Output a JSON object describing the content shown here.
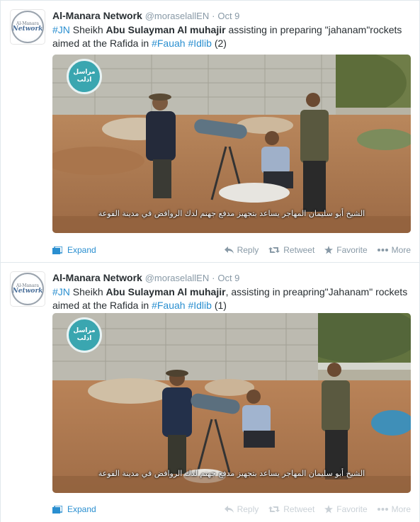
{
  "tweets": [
    {
      "avatar": {
        "line1": "Al-Manara",
        "line2": "Network"
      },
      "name": "Al-Manara Network",
      "handle": "@moraselallEN",
      "separator": "·",
      "time": "Oct 9",
      "text": {
        "hashtag1": "#JN",
        "p1": " Sheikh ",
        "bold": "Abu Sulayman Al muhajir",
        "p2": " assisting in preparing \"jahanam\"rockets aimed at the Rafida in ",
        "hashtag2": "#Fauah",
        "space": " ",
        "hashtag3": "#Idlib",
        "p3": " (2)"
      },
      "media": {
        "watermark_line1": "مراسل",
        "watermark_line2": "ادلب",
        "caption": "الشيخ أبو سليمان المهاجر يساعد بتجهيز مدفع جهنم لدك الروافض في مدينة الفوعة"
      },
      "actions": {
        "expand": "Expand",
        "reply": "Reply",
        "retweet": "Retweet",
        "favorite": "Favorite",
        "more": "More"
      }
    },
    {
      "avatar": {
        "line1": "Al-Manara",
        "line2": "Network"
      },
      "name": "Al-Manara Network",
      "handle": "@moraselallEN",
      "separator": "·",
      "time": "Oct 9",
      "text": {
        "hashtag1": "#JN",
        "p1": " Sheikh ",
        "bold": "Abu Sulayman Al muhajir",
        "p2": ", assisting in preapring\"Jahanam\" rockets aimed at the Rafida in ",
        "hashtag2": "#Fauah",
        "space": " ",
        "hashtag3": "#Idlib",
        "p3": " (1)"
      },
      "media": {
        "watermark_line1": "مراسل",
        "watermark_line2": "ادلب",
        "caption": "الشيخ أبو سليمان المهاجر يساعد بتجهيز مدفع جهنم لدك الروافض في مدينة الفوعة"
      },
      "actions": {
        "expand": "Expand",
        "reply": "Reply",
        "retweet": "Retweet",
        "favorite": "Favorite",
        "more": "More"
      }
    }
  ],
  "colors": {
    "link": "#2a8fd0",
    "muted": "#8899a6",
    "text": "#292f33",
    "border": "#e1e8ed"
  }
}
